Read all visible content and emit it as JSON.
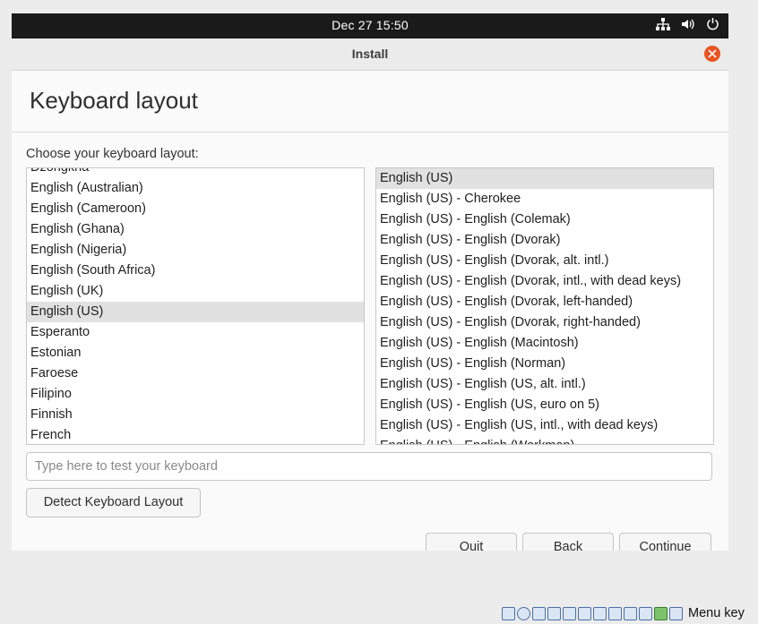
{
  "topbar": {
    "clock": "Dec 27  15:50"
  },
  "window": {
    "title": "Install"
  },
  "page": {
    "heading": "Keyboard layout",
    "choose_label": "Choose your keyboard layout:"
  },
  "layouts": [
    {
      "label": "Dzongkha",
      "selected": false
    },
    {
      "label": "English (Australian)",
      "selected": false
    },
    {
      "label": "English (Cameroon)",
      "selected": false
    },
    {
      "label": "English (Ghana)",
      "selected": false
    },
    {
      "label": "English (Nigeria)",
      "selected": false
    },
    {
      "label": "English (South Africa)",
      "selected": false
    },
    {
      "label": "English (UK)",
      "selected": false
    },
    {
      "label": "English (US)",
      "selected": true
    },
    {
      "label": "Esperanto",
      "selected": false
    },
    {
      "label": "Estonian",
      "selected": false
    },
    {
      "label": "Faroese",
      "selected": false
    },
    {
      "label": "Filipino",
      "selected": false
    },
    {
      "label": "Finnish",
      "selected": false
    },
    {
      "label": "French",
      "selected": false
    }
  ],
  "variants": [
    {
      "label": "English (US)",
      "selected": true
    },
    {
      "label": "English (US) - Cherokee",
      "selected": false
    },
    {
      "label": "English (US) - English (Colemak)",
      "selected": false
    },
    {
      "label": "English (US) - English (Dvorak)",
      "selected": false
    },
    {
      "label": "English (US) - English (Dvorak, alt. intl.)",
      "selected": false
    },
    {
      "label": "English (US) - English (Dvorak, intl., with dead keys)",
      "selected": false
    },
    {
      "label": "English (US) - English (Dvorak, left-handed)",
      "selected": false
    },
    {
      "label": "English (US) - English (Dvorak, right-handed)",
      "selected": false
    },
    {
      "label": "English (US) - English (Macintosh)",
      "selected": false
    },
    {
      "label": "English (US) - English (Norman)",
      "selected": false
    },
    {
      "label": "English (US) - English (US, alt. intl.)",
      "selected": false
    },
    {
      "label": "English (US) - English (US, euro on 5)",
      "selected": false
    },
    {
      "label": "English (US) - English (US, intl., with dead keys)",
      "selected": false
    },
    {
      "label": "English (US) - English (Workman)",
      "selected": false
    }
  ],
  "test_input": {
    "placeholder": "Type here to test your keyboard",
    "value": ""
  },
  "buttons": {
    "detect": "Detect Keyboard Layout",
    "quit": "Quit",
    "back": "Back",
    "continue": "Continue"
  },
  "statusbar": {
    "menu_key": "Menu key",
    "icons": [
      "hard-disk-icon",
      "optical-drive-icon",
      "audio-icon",
      "network-icon",
      "usb-icon",
      "shared-folder-icon",
      "display-icon",
      "recording-icon",
      "cpu-icon",
      "virtualization-icon",
      "mouse-integration-icon",
      "keyboard-capture-icon"
    ]
  },
  "colors": {
    "accent": "#e95420",
    "topbar": "#1a1a1a",
    "selection": "#e1e1e1"
  }
}
